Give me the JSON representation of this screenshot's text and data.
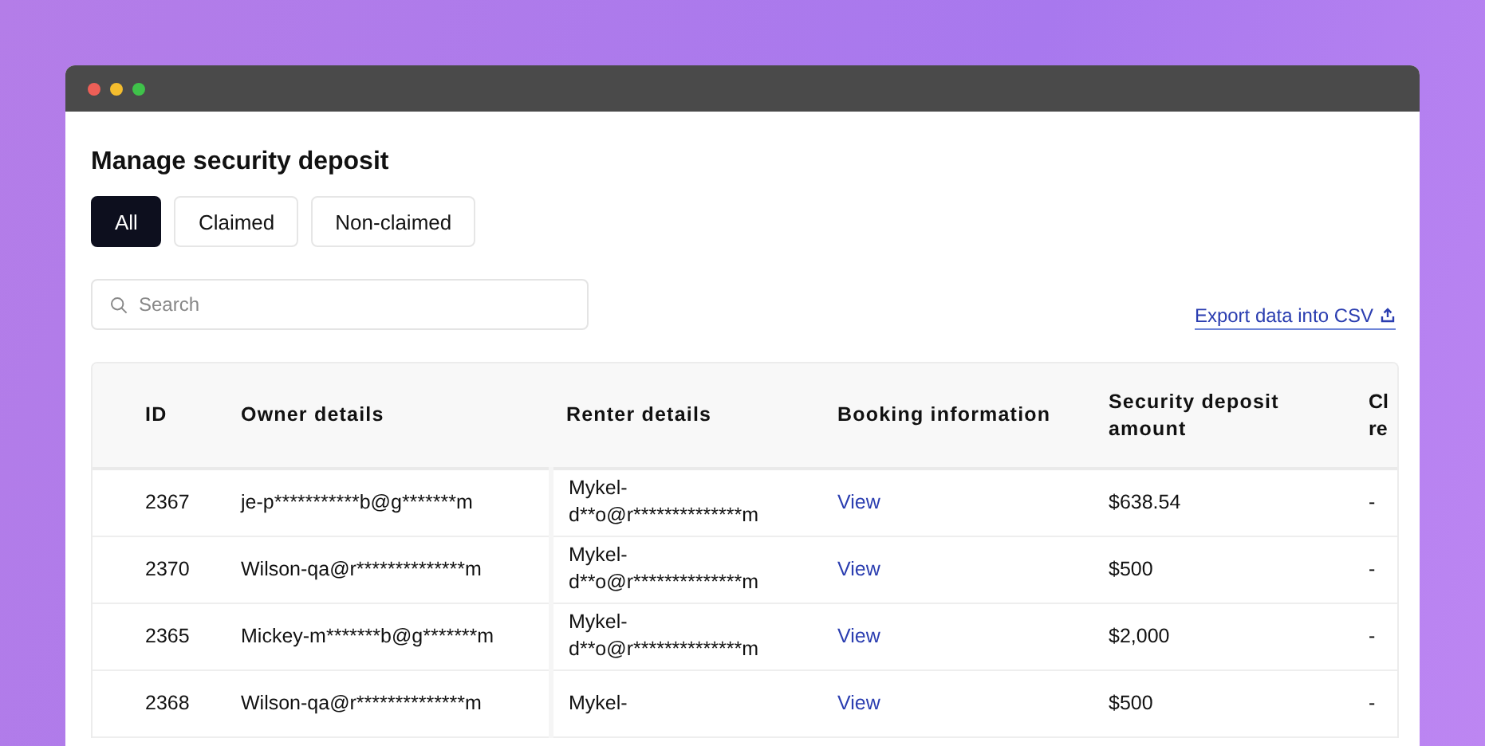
{
  "title": "Manage security deposit",
  "tabs": [
    {
      "label": "All",
      "selected": true
    },
    {
      "label": "Claimed",
      "selected": false
    },
    {
      "label": "Non-claimed",
      "selected": false
    }
  ],
  "search": {
    "placeholder": "Search"
  },
  "export_link": "Export data into CSV",
  "table": {
    "columns": [
      "ID",
      "Owner details",
      "Renter details",
      "Booking information",
      "Security deposit amount",
      "Cl re"
    ],
    "rows": [
      {
        "id": "2367",
        "owner": "je-p***********b@g*******m",
        "renter": [
          "Mykel-",
          "d**o@r**************m"
        ],
        "booking": "View",
        "amount": "$638.54",
        "column_6": "-"
      },
      {
        "id": "2370",
        "owner": "Wilson-qa@r**************m",
        "renter": [
          "Mykel-",
          "d**o@r**************m"
        ],
        "booking": "View",
        "amount": "$500",
        "column_6": "-"
      },
      {
        "id": "2365",
        "owner": "Mickey-m*******b@g*******m",
        "renter": [
          "Mykel-",
          "d**o@r**************m"
        ],
        "booking": "View",
        "amount": "$2,000",
        "column_6": "-"
      },
      {
        "id": "2368",
        "owner": "Wilson-qa@r**************m",
        "renter": [
          "Mykel-"
        ],
        "booking": "View",
        "amount": "$500",
        "column_6": "-"
      }
    ]
  }
}
